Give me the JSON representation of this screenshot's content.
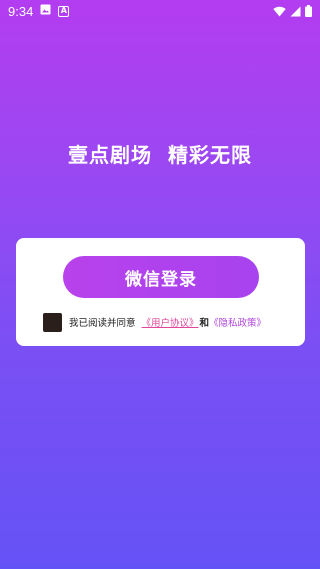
{
  "status_bar": {
    "time": "9:34",
    "icons": [
      "image-icon",
      "a-icon",
      "wifi-icon",
      "signal-icon",
      "battery-icon"
    ],
    "a_glyph": "A"
  },
  "slogan": {
    "part1": "壹点剧场",
    "part2": "精彩无限"
  },
  "login": {
    "button_label": "微信登录"
  },
  "agreement": {
    "prefix": "我已阅读并同意",
    "user_agreement": "《用户协议》",
    "and": "和",
    "privacy_policy": "《隐私政策》",
    "checked": false
  },
  "colors": {
    "bg_top": "#b33df0",
    "bg_bottom": "#6552f6",
    "button": "#b842ec",
    "link_pink": "#e0479b",
    "link_purple": "#b046dc",
    "checkbox": "#2a1f1a"
  }
}
